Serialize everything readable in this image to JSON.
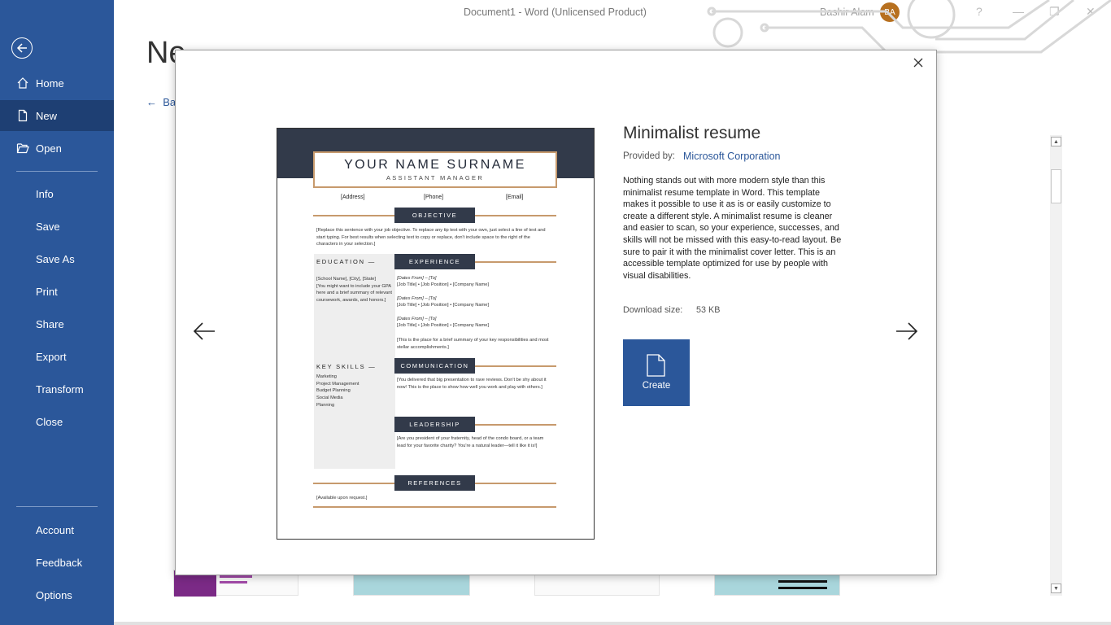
{
  "window": {
    "title": "Document1  -  Word (Unlicensed Product)",
    "user_name": "Bashir Alam",
    "user_initials": "BA"
  },
  "sidebar": {
    "items": [
      {
        "label": "Home"
      },
      {
        "label": "New"
      },
      {
        "label": "Open"
      },
      {
        "label": "Info"
      },
      {
        "label": "Save"
      },
      {
        "label": "Save As"
      },
      {
        "label": "Print"
      },
      {
        "label": "Share"
      },
      {
        "label": "Export"
      },
      {
        "label": "Transform"
      },
      {
        "label": "Close"
      },
      {
        "label": "Account"
      },
      {
        "label": "Feedback"
      },
      {
        "label": "Options"
      }
    ]
  },
  "backstage": {
    "heading": "Ne",
    "back_link": "Ba"
  },
  "modal": {
    "template_title": "Minimalist resume",
    "provided_by_label": "Provided by:",
    "provider": "Microsoft Corporation",
    "description": "Nothing stands out with more modern style than this minimalist resume template in Word. This template makes it possible to use it as is or easily customize to create a different style. A minimalist resume is cleaner and easier to scan, so your experience, successes, and skills will not be missed with this easy-to-read layout. Be sure to pair it with the minimalist cover letter. This is an accessible template optimized for use by people with visual disabilities.",
    "download_size_label": "Download size:",
    "download_size_value": "53 KB",
    "create_label": "Create"
  },
  "preview": {
    "name": "YOUR NAME SURNAME",
    "role": "ASSISTANT MANAGER",
    "address": "[Address]",
    "phone": "[Phone]",
    "email": "[Email]",
    "objective_head": "OBJECTIVE",
    "objective_text": "[Replace this sentence with your job objective. To replace any tip text with your own, just select a line of text and start typing. For best results when selecting text to copy or replace, don't include space to the right of the characters in your selection.]",
    "education_head": "EDUCATION",
    "education_text": "[School Name], [City], [State]\n[You might want to include your GPA here and a brief summary of relevant coursework, awards, and honors.]",
    "experience_head": "EXPERIENCE",
    "exp1_dates": "[Dates From] – [To]",
    "exp1_job": "[Job Title] • [Job Position] • [Company Name]",
    "exp2_dates": "[Dates From] – [To]",
    "exp2_job": "[Job Title] • [Job Position] • [Company Name]",
    "exp3_dates": "[Dates From] – [To]",
    "exp3_job": "[Job Title] • [Job Position] • [Company Name]",
    "exp_summary": "[This is the place for a brief summary of your key responsibilities and most stellar accomplishments.]",
    "skills_head": "KEY SKILLS",
    "skills_text": "Marketing\nProject Management\nBudget Planning\nSocial Media\nPlanning",
    "communication_head": "COMMUNICATION",
    "communication_text": "[You delivered that big presentation to rave reviews. Don't be shy about it now! This is the place to show how well you work and play with others.]",
    "leadership_head": "LEADERSHIP",
    "leadership_text": "[Are you president of your fraternity, head of the condo board, or a team lead for your favorite charity? You're a natural leader—tell it like it is!]",
    "references_head": "REFERENCES",
    "references_text": "[Available upon request.]"
  },
  "colors": {
    "accent": "#2b579a",
    "sidebar_active": "#1e3f73",
    "resume_dark": "#323a4a",
    "resume_line": "#c79a6d",
    "avatar": "#b7701f"
  }
}
